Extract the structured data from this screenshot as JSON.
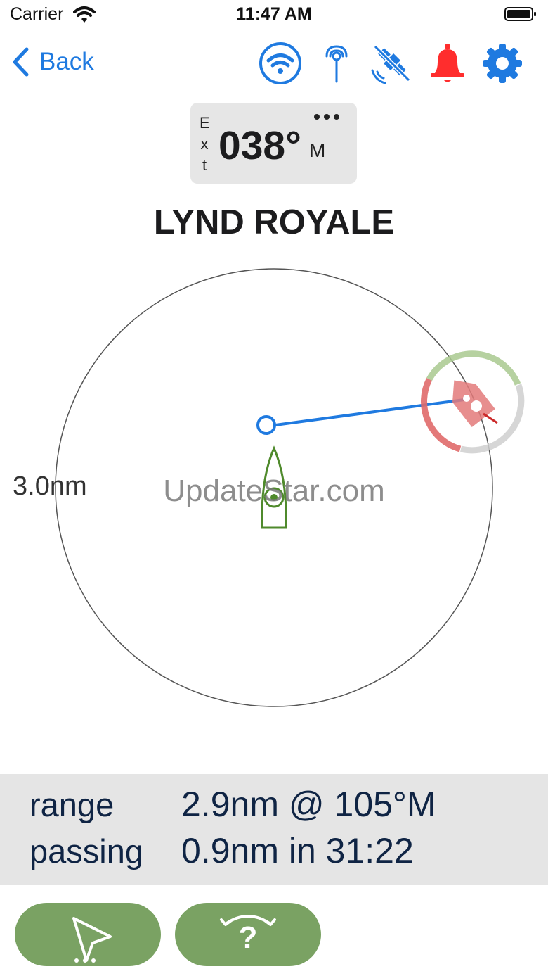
{
  "status_bar": {
    "carrier": "Carrier",
    "time": "11:47 AM"
  },
  "nav": {
    "back_label": "Back",
    "icons": [
      "wifi-circle-icon",
      "antenna-icon",
      "satellite-off-icon",
      "bell-icon",
      "gear-icon"
    ]
  },
  "heading": {
    "source_letters": [
      "E",
      "x",
      "t"
    ],
    "value": "038°",
    "unit": "M"
  },
  "target": {
    "name": "LYND ROYALE"
  },
  "radar": {
    "range_label": "3.0nm",
    "watermark": "UpdateStar.com"
  },
  "info": {
    "range_label": "range",
    "range_value": "2.9nm @ 105°M",
    "passing_label": "passing",
    "passing_value": "0.9nm in 31:22"
  },
  "actions": {
    "left_icon": "intercept-icon",
    "right_icon": "help-rotate-icon"
  },
  "colors": {
    "accent_blue": "#1f7ae0",
    "alarm_red": "#ff2d2d",
    "own_ship_green": "#4f8a2c",
    "button_green": "#7aa263",
    "target_red": "#e06a6a"
  }
}
